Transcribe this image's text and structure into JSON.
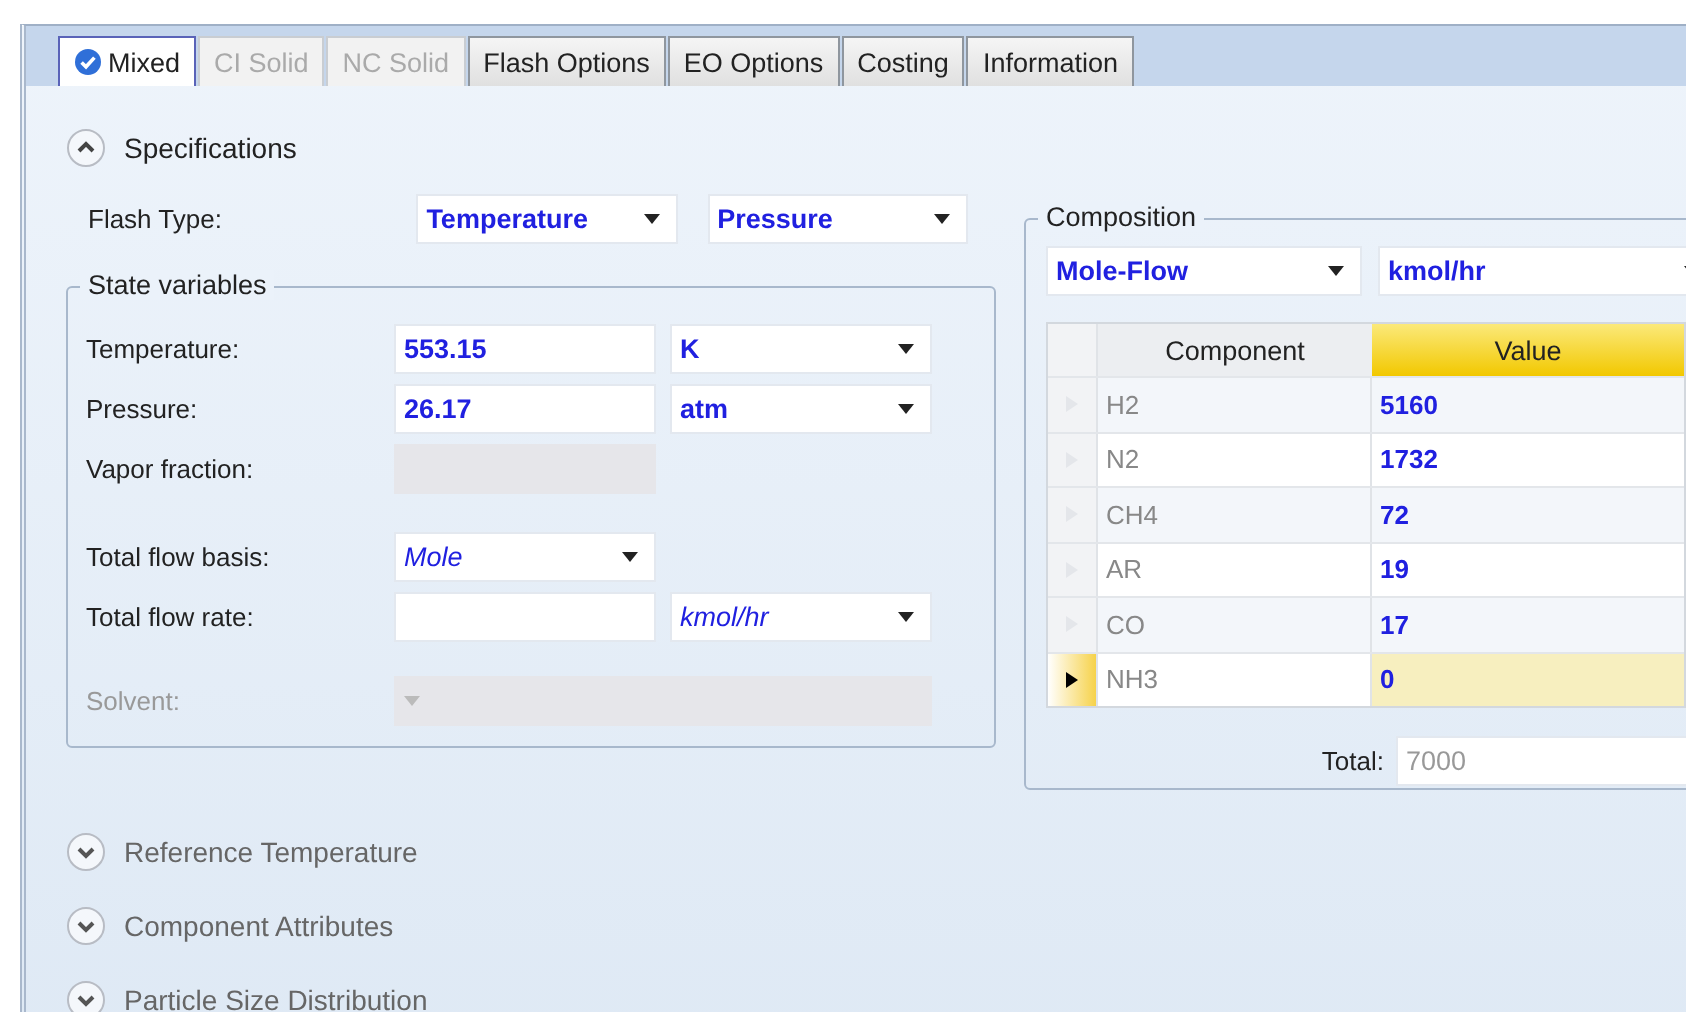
{
  "tabs": [
    {
      "label": "Mixed",
      "selected": true,
      "disabled": false,
      "complete": true
    },
    {
      "label": "CI Solid",
      "selected": false,
      "disabled": true,
      "complete": false
    },
    {
      "label": "NC Solid",
      "selected": false,
      "disabled": true,
      "complete": false
    },
    {
      "label": "Flash Options",
      "selected": false,
      "disabled": false,
      "complete": false
    },
    {
      "label": "EO Options",
      "selected": false,
      "disabled": false,
      "complete": false
    },
    {
      "label": "Costing",
      "selected": false,
      "disabled": false,
      "complete": false
    },
    {
      "label": "Information",
      "selected": false,
      "disabled": false,
      "complete": false
    }
  ],
  "specifications": {
    "title": "Specifications",
    "expanded": true,
    "flash_type": {
      "label": "Flash Type:",
      "spec_1": {
        "value": "Temperature"
      },
      "spec_2": {
        "value": "Pressure"
      }
    },
    "state_variables": {
      "title": "State variables",
      "rows": [
        {
          "label": "Temperature:",
          "disabled": false,
          "fields": [
            {
              "kind": "text",
              "value": "553.15",
              "default": false,
              "disabled": false
            },
            {
              "kind": "combo",
              "value": "K",
              "default": false,
              "disabled": false
            }
          ]
        },
        {
          "label": "Pressure:",
          "disabled": false,
          "fields": [
            {
              "kind": "text",
              "value": "26.17",
              "default": false,
              "disabled": false
            },
            {
              "kind": "combo",
              "value": "atm",
              "default": false,
              "disabled": false
            }
          ]
        },
        {
          "label": "Vapor fraction:",
          "disabled": false,
          "fields": [
            {
              "kind": "text",
              "default": false,
              "disabled": true
            }
          ]
        },
        {
          "label": "Total flow basis:",
          "disabled": false,
          "fields": [
            {
              "kind": "combo",
              "value": "Mole",
              "default": true,
              "disabled": false
            }
          ]
        },
        {
          "label": "Total flow rate:",
          "disabled": false,
          "fields": [
            {
              "kind": "text",
              "default": false,
              "disabled": false
            },
            {
              "kind": "combo",
              "value": "kmol/hr",
              "default": true,
              "disabled": false
            }
          ]
        },
        {
          "label": "Solvent:",
          "disabled": true,
          "fields": [
            {
              "kind": "wide-combo",
              "default": false,
              "disabled": true
            }
          ]
        }
      ]
    },
    "composition": {
      "title": "Composition",
      "basis": {
        "value": "Mole-Flow"
      },
      "units": {
        "value": "kmol/hr"
      },
      "columns": [
        "Component",
        "Value"
      ],
      "rows": [
        {
          "component": "H2",
          "value": "5160",
          "selected": false
        },
        {
          "component": "N2",
          "value": "1732",
          "selected": false
        },
        {
          "component": "CH4",
          "value": "72",
          "selected": false
        },
        {
          "component": "AR",
          "value": "19",
          "selected": false
        },
        {
          "component": "CO",
          "value": "17",
          "selected": false
        },
        {
          "component": "NH3",
          "value": "0",
          "selected": true
        }
      ],
      "total_label": "Total:",
      "total": "7000"
    }
  },
  "other_sections": [
    {
      "title": "Reference Temperature",
      "expanded": false
    },
    {
      "title": "Component Attributes",
      "expanded": false
    },
    {
      "title": "Particle Size Distribution",
      "expanded": false
    }
  ]
}
